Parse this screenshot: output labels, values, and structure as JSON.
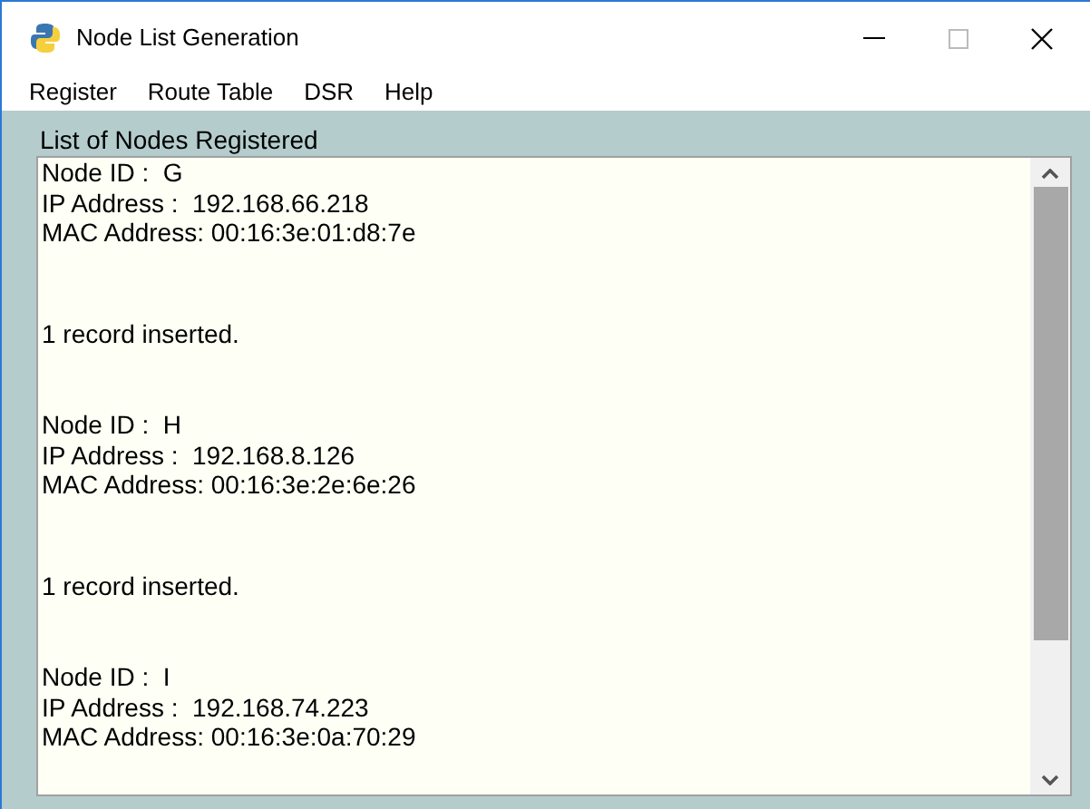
{
  "window": {
    "title": "Node List Generation"
  },
  "menu": [
    "Register",
    "Route Table",
    "DSR",
    "Help"
  ],
  "panel": {
    "title": "List of Nodes Registered"
  },
  "records": [
    {
      "node_id": "Node ID :  G",
      "ip": "IP Address :  192.168.66.218",
      "mac": "MAC Address: 00:16:3e:01:d8:7e",
      "status": "1 record inserted."
    },
    {
      "node_id": "Node ID :  H",
      "ip": "IP Address :  192.168.8.126",
      "mac": "MAC Address: 00:16:3e:2e:6e:26",
      "status": "1 record inserted."
    },
    {
      "node_id": "Node ID :  I",
      "ip": "IP Address :  192.168.74.223",
      "mac": "MAC Address: 00:16:3e:0a:70:29"
    }
  ]
}
